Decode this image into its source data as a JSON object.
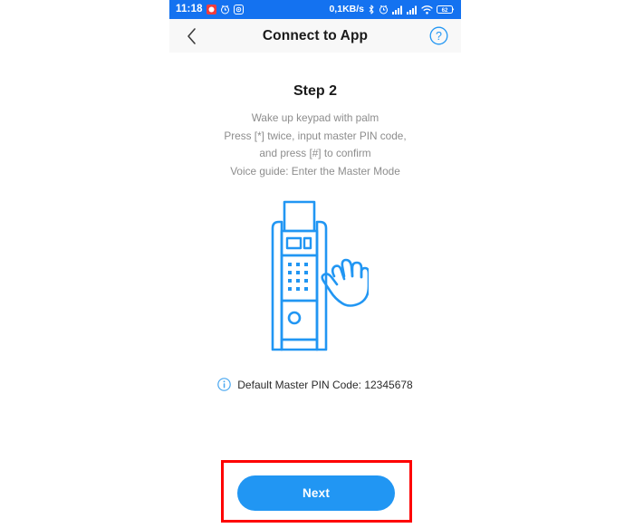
{
  "status_bar": {
    "clock": "11:18",
    "network_speed": "0,1KB/s",
    "battery_level": "62",
    "left_icons": [
      "record-icon",
      "alarm-clock-icon",
      "app-badge-icon"
    ],
    "right_icons": [
      "bluetooth-icon",
      "alarm-icon",
      "signal-bars-icon",
      "signal-bars-icon",
      "wifi-icon",
      "battery-icon"
    ],
    "background_color": "#1472f0"
  },
  "header": {
    "title": "Connect to App",
    "back_icon": "chevron-left-icon",
    "help_icon": "question-mark-circle-icon",
    "background_color": "#f8f8f8"
  },
  "main": {
    "step_title": "Step 2",
    "instructions": [
      "Wake up keypad with palm",
      "Press [*] twice, input master PIN code,",
      "and press [#] to confirm",
      "Voice guide: Enter the Master Mode"
    ],
    "illustration": {
      "name": "smart-door-lock-with-palm-hand-illustration",
      "stroke_color": "#2196f3",
      "keypad_rows": 4,
      "keypad_cols": 3
    },
    "pin_note": {
      "icon": "info-circle-icon",
      "text": "Default Master PIN Code: 12345678"
    }
  },
  "footer": {
    "next_label": "Next",
    "button_color": "#2196f3",
    "highlight_box_color": "#fe0000"
  }
}
